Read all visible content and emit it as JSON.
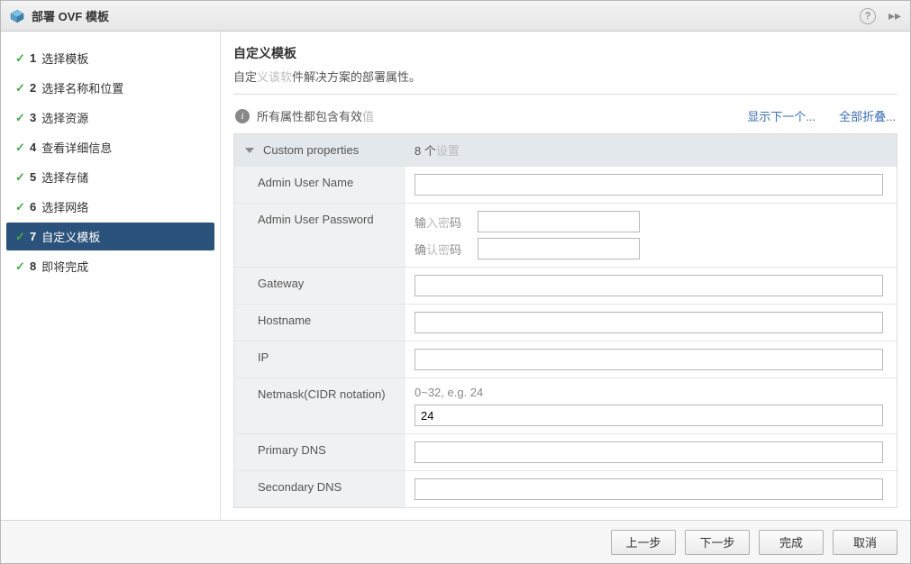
{
  "titlebar": {
    "title": "部署 OVF 模板"
  },
  "sidebar": {
    "steps": [
      {
        "num": "1",
        "label": "选择模板"
      },
      {
        "num": "2",
        "label": "选择名称和位置"
      },
      {
        "num": "3",
        "label": "选择资源"
      },
      {
        "num": "4",
        "label": "查看详细信息"
      },
      {
        "num": "5",
        "label": "选择存储"
      },
      {
        "num": "6",
        "label": "选择网络"
      },
      {
        "num": "7",
        "label": "自定义模板"
      },
      {
        "num": "8",
        "label": "即将完成"
      }
    ]
  },
  "main": {
    "heading": "自定义模板",
    "desc_prefix": "自定",
    "desc_faded": "义该软",
    "desc_suffix": "件解决方案的部署属性。",
    "status_prefix": "所有属性都包含有效",
    "status_faded": "值",
    "link_show_next": "显示下一个...",
    "link_collapse": "全部折叠...",
    "section_label": "Custom properties",
    "section_count_prefix": "8 个",
    "section_count_faded": "设置",
    "fields": {
      "admin_user_name": "Admin User Name",
      "admin_user_password": "Admin User Password",
      "pwd_enter_prefix": "输",
      "pwd_enter_faded": "入密",
      "pwd_enter_suffix": "码",
      "pwd_confirm_prefix": "确",
      "pwd_confirm_faded": "认密",
      "pwd_confirm_suffix": "码",
      "gateway": "Gateway",
      "hostname": "Hostname",
      "ip": "IP",
      "netmask": "Netmask(CIDR notation)",
      "netmask_hint": "0~32, e.g. 24",
      "netmask_value": "24",
      "primary_dns": "Primary DNS",
      "secondary_dns": "Secondary DNS"
    }
  },
  "footer": {
    "back": "上一步",
    "next": "下一步",
    "finish": "完成",
    "cancel": "取消"
  }
}
